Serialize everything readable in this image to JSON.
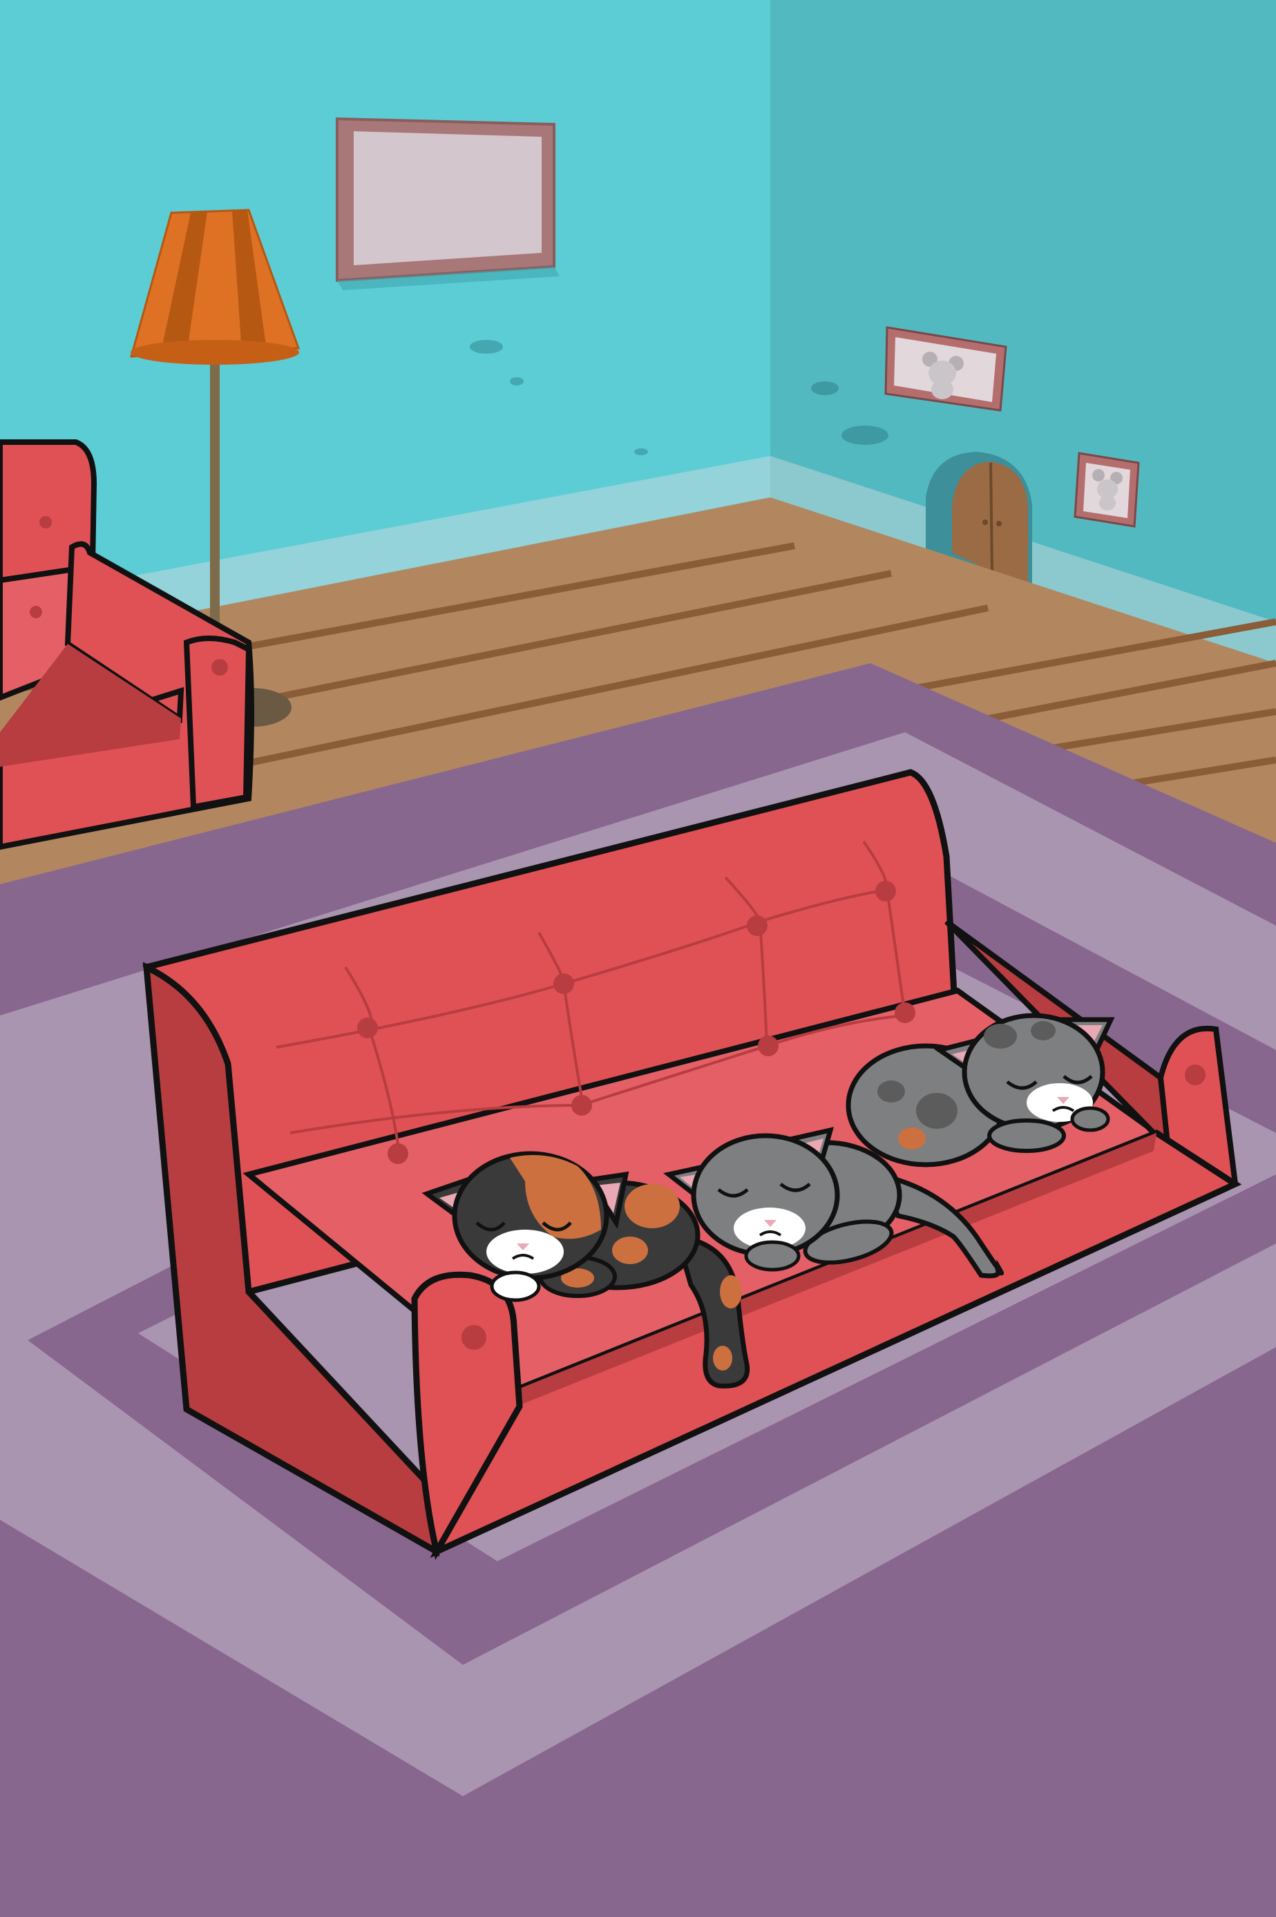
{
  "scene": {
    "kind": "cartoon-illustration",
    "setting": "living-room",
    "colors": {
      "wall_left": "#5ccdd5",
      "wall_right": "#53b9c0",
      "baseboard": "#93d3d9",
      "floor": "#b2875f",
      "floor_plank": "#8a5c37",
      "rug_outer": "#88678f",
      "rug_band": "#aa95b0",
      "sofa": "#e05155",
      "sofa_shadow": "#b73d40",
      "outline": "#111111",
      "lamp_shade": "#de7124",
      "frame": "#a07272",
      "frame_inner": "#d3c6cd",
      "mouse_door": "#9a6b45",
      "cat_dark": "#3a3a3a",
      "cat_orange": "#cc7040",
      "cat_gray": "#7e7f80",
      "cat_gray_dark": "#5c5c5c",
      "cat_white": "#ffffff",
      "cat_ear_pink": "#e9a8b4"
    },
    "objects": [
      {
        "name": "empty-picture-frame"
      },
      {
        "name": "floor-lamp"
      },
      {
        "name": "armchair"
      },
      {
        "name": "mouse-picture"
      },
      {
        "name": "mouse-picture-small"
      },
      {
        "name": "mouse-hole-door"
      },
      {
        "name": "rug"
      },
      {
        "name": "sofa"
      },
      {
        "name": "calico-cat",
        "state": "sleeping"
      },
      {
        "name": "gray-cat",
        "state": "sleeping"
      },
      {
        "name": "gray-calico-cat",
        "state": "sleeping"
      }
    ]
  }
}
